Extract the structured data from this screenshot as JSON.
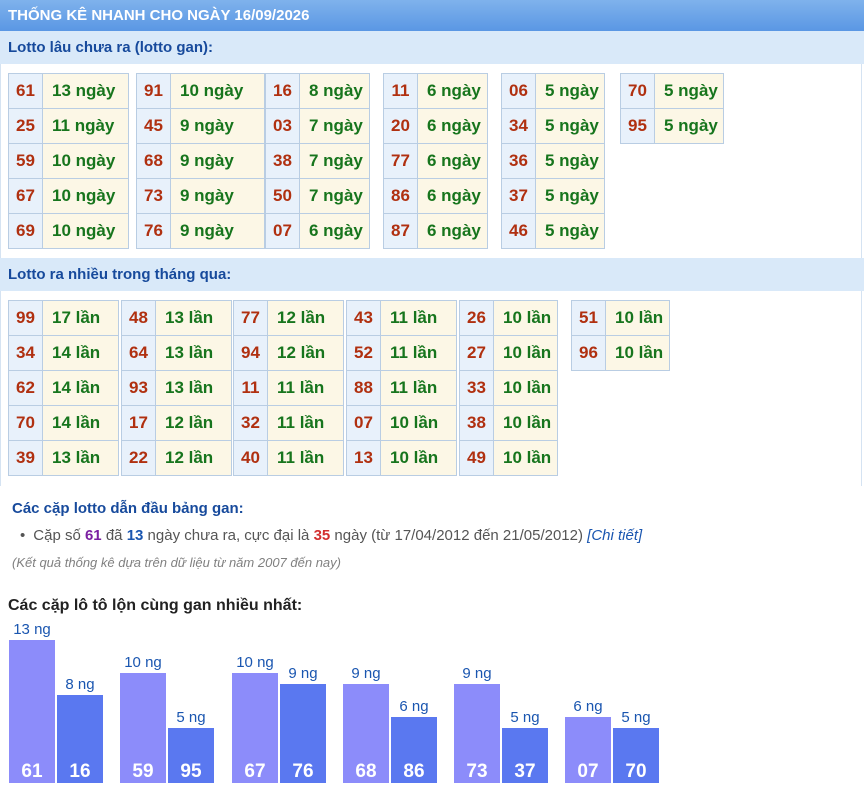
{
  "header": {
    "title": "THỐNG KÊ NHANH CHO NGÀY 16/09/2026"
  },
  "gan_section": {
    "title": "Lotto lâu chưa ra (lotto gan):",
    "columns": [
      [
        {
          "num": "61",
          "val": "13 ngày"
        },
        {
          "num": "25",
          "val": "11 ngày"
        },
        {
          "num": "59",
          "val": "10 ngày"
        },
        {
          "num": "67",
          "val": "10 ngày"
        },
        {
          "num": "69",
          "val": "10 ngày"
        }
      ],
      [
        {
          "num": "91",
          "val": "10 ngày"
        },
        {
          "num": "45",
          "val": "9 ngày"
        },
        {
          "num": "68",
          "val": "9 ngày"
        },
        {
          "num": "73",
          "val": "9 ngày"
        },
        {
          "num": "76",
          "val": "9 ngày"
        }
      ],
      [
        {
          "num": "16",
          "val": "8 ngày"
        },
        {
          "num": "03",
          "val": "7 ngày"
        },
        {
          "num": "38",
          "val": "7 ngày"
        },
        {
          "num": "50",
          "val": "7 ngày"
        },
        {
          "num": "07",
          "val": "6 ngày"
        }
      ],
      [
        {
          "num": "11",
          "val": "6 ngày"
        },
        {
          "num": "20",
          "val": "6 ngày"
        },
        {
          "num": "77",
          "val": "6 ngày"
        },
        {
          "num": "86",
          "val": "6 ngày"
        },
        {
          "num": "87",
          "val": "6 ngày"
        }
      ],
      [
        {
          "num": "06",
          "val": "5 ngày"
        },
        {
          "num": "34",
          "val": "5 ngày"
        },
        {
          "num": "36",
          "val": "5 ngày"
        },
        {
          "num": "37",
          "val": "5 ngày"
        },
        {
          "num": "46",
          "val": "5 ngày"
        }
      ],
      [
        {
          "num": "70",
          "val": "5 ngày"
        },
        {
          "num": "95",
          "val": "5 ngày"
        }
      ]
    ]
  },
  "frequent_section": {
    "title": "Lotto ra nhiều trong tháng qua:",
    "columns": [
      [
        {
          "num": "99",
          "val": "17 lần"
        },
        {
          "num": "34",
          "val": "14 lần"
        },
        {
          "num": "62",
          "val": "14 lần"
        },
        {
          "num": "70",
          "val": "14 lần"
        },
        {
          "num": "39",
          "val": "13 lần"
        }
      ],
      [
        {
          "num": "48",
          "val": "13 lần"
        },
        {
          "num": "64",
          "val": "13 lần"
        },
        {
          "num": "93",
          "val": "13 lần"
        },
        {
          "num": "17",
          "val": "12 lần"
        },
        {
          "num": "22",
          "val": "12 lần"
        }
      ],
      [
        {
          "num": "77",
          "val": "12 lần"
        },
        {
          "num": "94",
          "val": "12 lần"
        },
        {
          "num": "11",
          "val": "11 lần"
        },
        {
          "num": "32",
          "val": "11 lần"
        },
        {
          "num": "40",
          "val": "11 lần"
        }
      ],
      [
        {
          "num": "43",
          "val": "11 lần"
        },
        {
          "num": "52",
          "val": "11 lần"
        },
        {
          "num": "88",
          "val": "11 lần"
        },
        {
          "num": "07",
          "val": "10 lần"
        },
        {
          "num": "13",
          "val": "10 lần"
        }
      ],
      [
        {
          "num": "26",
          "val": "10 lần"
        },
        {
          "num": "27",
          "val": "10 lần"
        },
        {
          "num": "33",
          "val": "10 lần"
        },
        {
          "num": "38",
          "val": "10 lần"
        },
        {
          "num": "49",
          "val": "10 lần"
        }
      ],
      [
        {
          "num": "51",
          "val": "10 lần"
        },
        {
          "num": "96",
          "val": "10 lần"
        }
      ]
    ]
  },
  "pair_section": {
    "title": "Các cặp lotto dẫn đầu bảng gan:",
    "prefix": "Cặp số",
    "pair_num": "61",
    "mid1": "đã",
    "days": "13",
    "mid2": "ngày chưa ra, cực đại là",
    "max": "35",
    "suffix": "ngày (từ 17/04/2012 đến 21/05/2012)",
    "link": "[Chi tiết]",
    "note": "(Kết quả thống kê dựa trên dữ liệu từ năm 2007 đến nay)"
  },
  "bar_section": {
    "title": "Các cặp lô tô lộn cùng gan nhiều nhất:"
  },
  "chart_data": {
    "type": "bar",
    "unit": "ng",
    "groups": [
      {
        "bars": [
          {
            "label": "61",
            "value": 13
          },
          {
            "label": "16",
            "value": 8
          }
        ]
      },
      {
        "bars": [
          {
            "label": "59",
            "value": 10
          },
          {
            "label": "95",
            "value": 5
          }
        ]
      },
      {
        "bars": [
          {
            "label": "67",
            "value": 10
          },
          {
            "label": "76",
            "value": 9
          }
        ]
      },
      {
        "bars": [
          {
            "label": "68",
            "value": 9
          },
          {
            "label": "86",
            "value": 6
          }
        ]
      },
      {
        "bars": [
          {
            "label": "73",
            "value": 9
          },
          {
            "label": "37",
            "value": 5
          }
        ]
      },
      {
        "bars": [
          {
            "label": "07",
            "value": 6
          },
          {
            "label": "70",
            "value": 5
          }
        ]
      }
    ],
    "colors": {
      "first": "#8c8cfa",
      "second": "#5a78f0",
      "label": "#1a56b0",
      "bar_text": "#ffffff"
    }
  }
}
